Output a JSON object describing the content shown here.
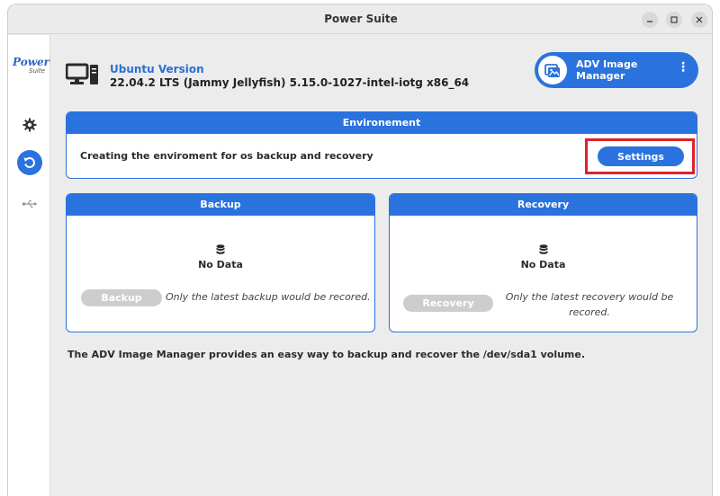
{
  "window": {
    "title": "Power Suite"
  },
  "sidebar": {
    "logo_line1": "Power",
    "logo_line2": "Suite"
  },
  "header": {
    "os_label": "Ubuntu Version",
    "os_value": "22.04.2 LTS (Jammy Jellyfish) 5.15.0-1027-intel-iotg x86_64",
    "app_name": "ADV Image Manager",
    "more_glyph": "⋮"
  },
  "environment": {
    "title": "Environement",
    "description": "Creating the enviroment for os backup and recovery",
    "settings_label": "Settings"
  },
  "backup": {
    "title": "Backup",
    "status": "No Data",
    "button_label": "Backup",
    "note": "Only the latest backup would be recored."
  },
  "recovery": {
    "title": "Recovery",
    "status": "No Data",
    "button_label": "Recovery",
    "note": "Only the latest recovery would be recored."
  },
  "footer": {
    "text": "The ADV Image Manager provides an easy way to backup and recover the /dev/sda1 volume."
  },
  "colors": {
    "accent": "#2a73de",
    "highlight": "#e0202a",
    "disabled": "#cdcdcd"
  },
  "icons": [
    "minimize-icon",
    "maximize-icon",
    "close-icon",
    "gear-icon",
    "restore-icon",
    "usb-icon",
    "computer-icon",
    "image-manager-icon",
    "database-icon"
  ]
}
